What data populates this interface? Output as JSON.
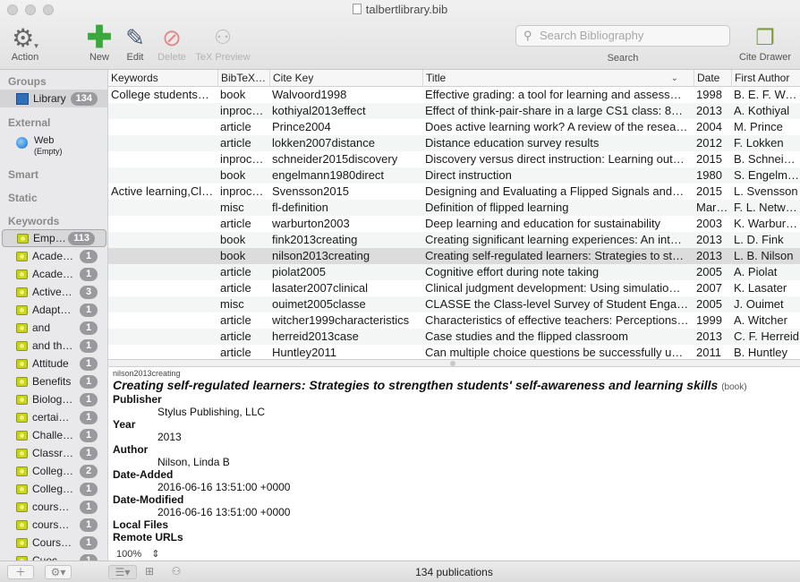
{
  "window": {
    "title": "talbertlibrary.bib"
  },
  "toolbar": {
    "action": "Action",
    "new": "New",
    "edit": "Edit",
    "delete": "Delete",
    "tex_preview": "TeX Preview",
    "search_placeholder": "Search Bibliography",
    "search_label": "Search",
    "cite_drawer": "Cite Drawer"
  },
  "sidebar": {
    "groups_header": "Groups",
    "library": {
      "label": "Library",
      "count": "134"
    },
    "external_header": "External",
    "web": {
      "label": "Web",
      "sub": "(Empty)"
    },
    "smart_header": "Smart",
    "static_header": "Static",
    "keywords_header": "Keywords",
    "keywords": [
      {
        "label": "Empt…",
        "count": "113"
      },
      {
        "label": "Acade…",
        "count": "1"
      },
      {
        "label": "Acade…",
        "count": "1"
      },
      {
        "label": "Active…",
        "count": "3"
      },
      {
        "label": "Adapt…",
        "count": "1"
      },
      {
        "label": "and",
        "count": "1"
      },
      {
        "label": "and th…",
        "count": "1"
      },
      {
        "label": "Attitude",
        "count": "1"
      },
      {
        "label": "Benefits",
        "count": "1"
      },
      {
        "label": "Biolog…",
        "count": "1"
      },
      {
        "label": "certai…",
        "count": "1"
      },
      {
        "label": "Challe…",
        "count": "1"
      },
      {
        "label": "Classr…",
        "count": "1"
      },
      {
        "label": "Colleg…",
        "count": "2"
      },
      {
        "label": "Colleg…",
        "count": "1"
      },
      {
        "label": "cours…",
        "count": "1"
      },
      {
        "label": "cours…",
        "count": "1"
      },
      {
        "label": "Cours…",
        "count": "1"
      },
      {
        "label": "Cuec…",
        "count": "1"
      }
    ]
  },
  "table": {
    "columns": [
      "Keywords",
      "BibTeX…",
      "Cite Key",
      "Title",
      "Date",
      "First Author"
    ],
    "rows": [
      {
        "keywords": "College students…",
        "type": "book",
        "key": "Walvoord1998",
        "title": "Effective grading: a tool for learning and assess…",
        "date": "1998",
        "author": "B. E. F. Wal…"
      },
      {
        "keywords": "",
        "type": "inproc…",
        "key": "kothiyal2013effect",
        "title": "Effect of think-pair-share in a large CS1 class: 8…",
        "date": "2013",
        "author": "A. Kothiyal"
      },
      {
        "keywords": "",
        "type": "article",
        "key": "Prince2004",
        "title": "Does active learning work? A review of the resea…",
        "date": "2004",
        "author": "M. Prince"
      },
      {
        "keywords": "",
        "type": "article",
        "key": "lokken2007distance",
        "title": "Distance education survey results",
        "date": "2012",
        "author": "F. Lokken"
      },
      {
        "keywords": "",
        "type": "inproc…",
        "key": "schneider2015discovery",
        "title": "Discovery versus direct instruction: Learning out…",
        "date": "2015",
        "author": "B. Schneider"
      },
      {
        "keywords": "",
        "type": "book",
        "key": "engelmann1980direct",
        "title": "Direct instruction",
        "date": "1980",
        "author": "S. Engelma…"
      },
      {
        "keywords": "Active learning,Cl…",
        "type": "inproc…",
        "key": "Svensson2015",
        "title": "Designing and Evaluating a Flipped Signals and…",
        "date": "2015",
        "author": "L. Svensson"
      },
      {
        "keywords": "",
        "type": "misc",
        "key": "fl-definition",
        "title": "Definition of flipped learning",
        "date": "Mar…",
        "author": "F. L. Netw…"
      },
      {
        "keywords": "",
        "type": "article",
        "key": "warburton2003",
        "title": "Deep learning and education for sustainability",
        "date": "2003",
        "author": "K. Warburt…"
      },
      {
        "keywords": "",
        "type": "book",
        "key": "fink2013creating",
        "title": "Creating significant learning experiences: An int…",
        "date": "2013",
        "author": "L. D. Fink"
      },
      {
        "keywords": "",
        "type": "book",
        "key": "nilson2013creating",
        "title": "Creating self-regulated learners: Strategies to st…",
        "date": "2013",
        "author": "L. B. Nilson"
      },
      {
        "keywords": "",
        "type": "article",
        "key": "piolat2005",
        "title": "Cognitive effort during note taking",
        "date": "2005",
        "author": "A. Piolat"
      },
      {
        "keywords": "",
        "type": "article",
        "key": "lasater2007clinical",
        "title": "Clinical judgment development: Using simulatio…",
        "date": "2007",
        "author": "K. Lasater"
      },
      {
        "keywords": "",
        "type": "misc",
        "key": "ouimet2005classe",
        "title": "CLASSE the Class-level Survey of Student Engag…",
        "date": "2005",
        "author": "J. Ouimet"
      },
      {
        "keywords": "",
        "type": "article",
        "key": "witcher1999characteristics",
        "title": "Characteristics of effective teachers: Perceptions…",
        "date": "1999",
        "author": "A. Witcher"
      },
      {
        "keywords": "",
        "type": "article",
        "key": "herreid2013case",
        "title": "Case studies and the flipped classroom",
        "date": "2013",
        "author": "C. F. Herreid"
      },
      {
        "keywords": "",
        "type": "article",
        "key": "Huntley2011",
        "title": "Can multiple choice questions be successfully u…",
        "date": "2011",
        "author": "B. Huntley"
      }
    ]
  },
  "preview": {
    "cite_key": "nilson2013creating",
    "title": "Creating self-regulated learners: Strategies to strengthen students' self-awareness and learning skills",
    "type": "(book)",
    "publisher_label": "Publisher",
    "publisher": "Stylus Publishing, LLC",
    "year_label": "Year",
    "year": "2013",
    "author_label": "Author",
    "author": "Nilson, Linda B",
    "date_added_label": "Date-Added",
    "date_added": "2016-06-16 13:51:00 +0000",
    "date_modified_label": "Date-Modified",
    "date_modified": "2016-06-16 13:51:00 +0000",
    "local_files_label": "Local Files",
    "remote_urls_label": "Remote URLs",
    "zoom": "100%"
  },
  "status": {
    "count": "134 publications"
  }
}
